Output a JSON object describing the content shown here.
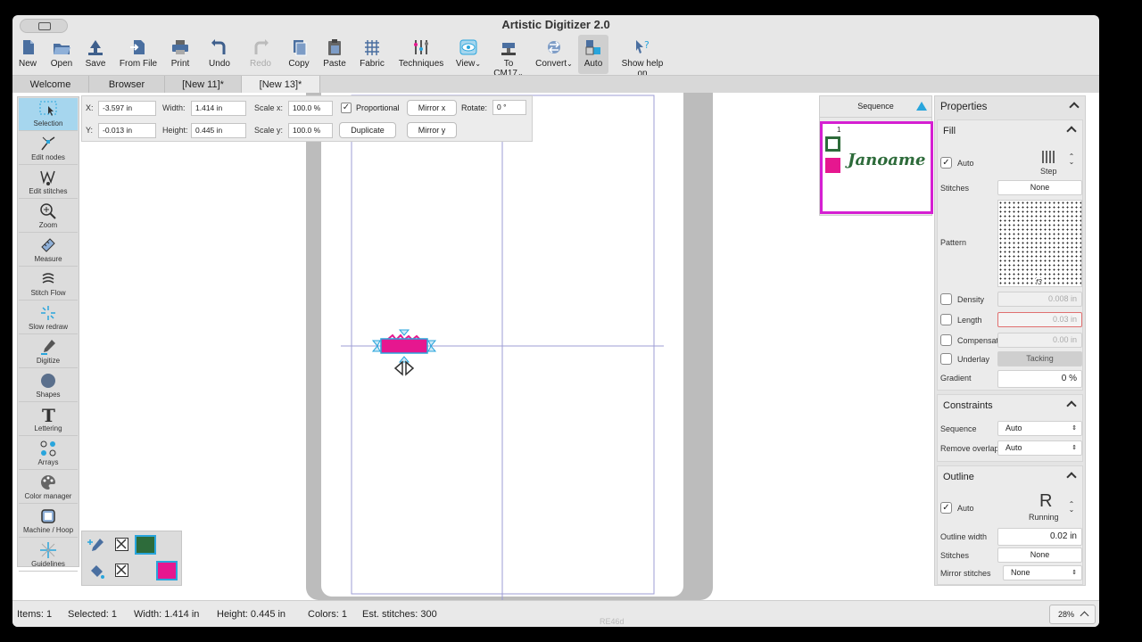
{
  "window": {
    "title": "Artistic Digitizer 2.0"
  },
  "toolbar": {
    "new": "New",
    "open": "Open",
    "save": "Save",
    "from_file": "From File",
    "print": "Print",
    "undo": "Undo",
    "redo": "Redo",
    "copy": "Copy",
    "paste": "Paste",
    "fabric": "Fabric",
    "techniques": "Techniques",
    "view": "View",
    "to_cm17": "To CM17",
    "convert": "Convert",
    "auto": "Auto",
    "show_help": "Show help on"
  },
  "tabs": [
    "Welcome",
    "Browser",
    "[New 11]*",
    "[New 13]*"
  ],
  "tools": [
    "Selection",
    "Edit nodes",
    "Edit stitches",
    "Zoom",
    "Measure",
    "Stitch Flow",
    "Slow redraw",
    "Digitize",
    "Shapes",
    "Lettering",
    "Arrays",
    "Color manager",
    "Machine / Hoop",
    "Guidelines"
  ],
  "props_bar": {
    "x_label": "X:",
    "x_value": "-3.597 in",
    "y_label": "Y:",
    "y_value": "-0.013 in",
    "width_label": "Width:",
    "width_value": "1.414 in",
    "height_label": "Height:",
    "height_value": "0.445 in",
    "scale_x_label": "Scale x:",
    "scale_x_value": "100.0 %",
    "scale_y_label": "Scale y:",
    "scale_y_value": "100.0 %",
    "proportional": "Proportional",
    "mirror_x": "Mirror x",
    "mirror_y": "Mirror y",
    "rotate_label": "Rotate:",
    "rotate_value": "0 °",
    "duplicate": "Duplicate"
  },
  "sequence": {
    "title": "Sequence",
    "item_number": "1",
    "item_text": "Janoame"
  },
  "properties": {
    "title": "Properties",
    "fill": {
      "title": "Fill",
      "auto": "Auto",
      "step": "Step",
      "stitches_label": "Stitches",
      "stitches_value": "None",
      "pattern_label": "Pattern",
      "pattern_code": "f3",
      "density_label": "Density",
      "density_value": "0.008 in",
      "length_label": "Length",
      "length_value": "0.03 in",
      "compensation_label": "Compensation",
      "compensation_value": "0.00 in",
      "underlay_label": "Underlay",
      "underlay_value": "Tacking",
      "gradient_label": "Gradient",
      "gradient_value": "0 %"
    },
    "constraints": {
      "title": "Constraints",
      "sequence_label": "Sequence",
      "sequence_value": "Auto",
      "remove_overlaps_label": "Remove overlaps",
      "remove_overlaps_value": "Auto"
    },
    "outline": {
      "title": "Outline",
      "auto": "Auto",
      "running": "Running",
      "width_label": "Outline width",
      "width_value": "0.02 in",
      "stitches_label": "Stitches",
      "stitches_value": "None",
      "mirror_label": "Mirror stitches",
      "mirror_value": "None"
    }
  },
  "status": {
    "items": "Items: 1",
    "selected": "Selected: 1",
    "width": "Width: 1.414 in",
    "height": "Height: 0.445 in",
    "colors": "Colors: 1",
    "stitches": "Est. stitches: 300",
    "zoom": "28%",
    "hoop_label": "RE46d"
  },
  "colors": {
    "accent": "#29a5dc",
    "magenta": "#e6178f",
    "green": "#2d6b3a",
    "sequence_border": "#d51fd2"
  }
}
